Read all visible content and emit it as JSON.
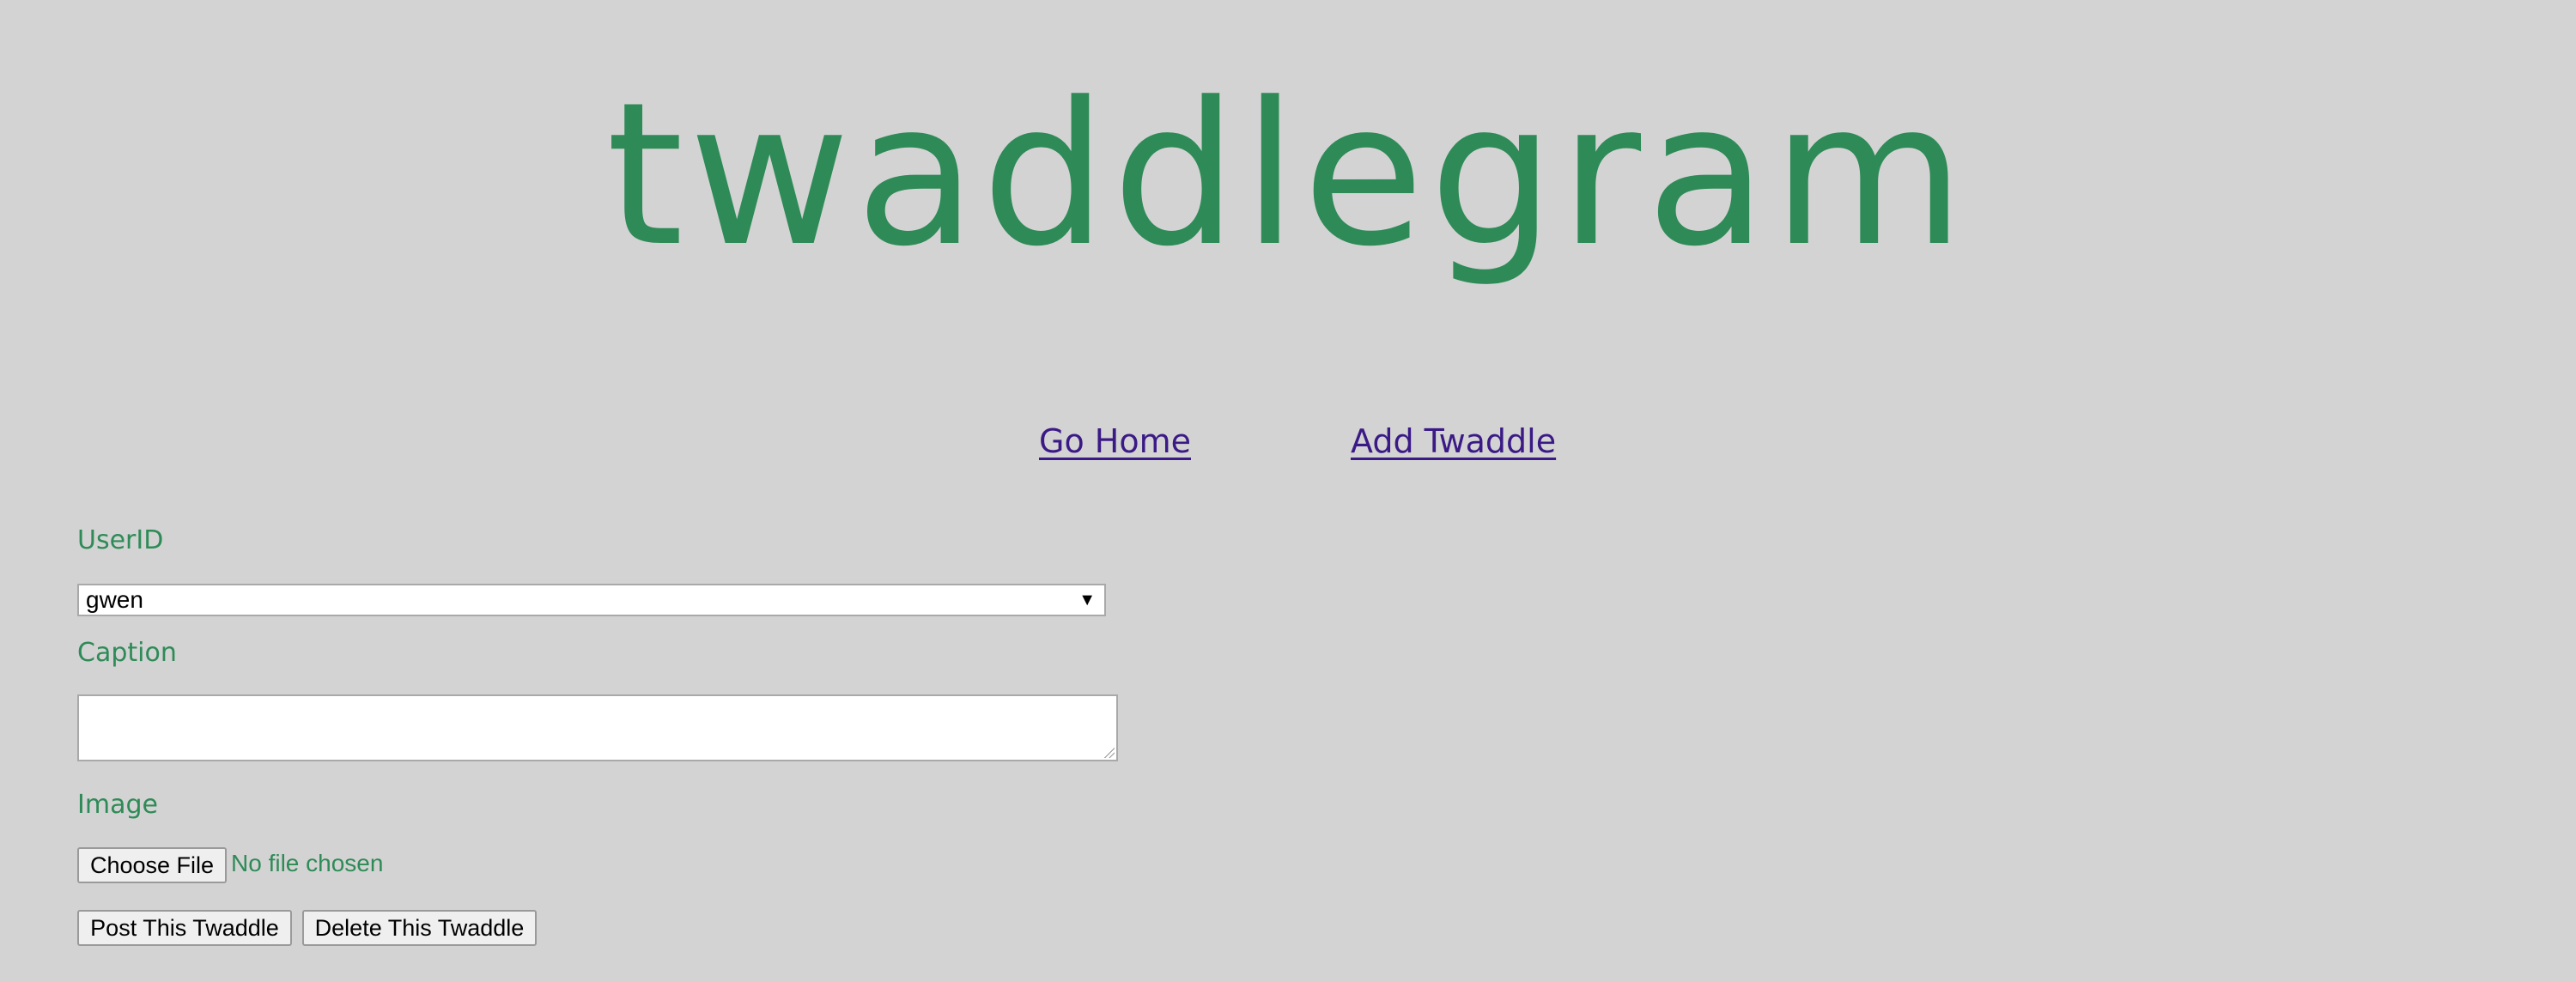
{
  "header": {
    "logo_text": "twaddlegram"
  },
  "nav": {
    "home_label": "Go Home",
    "add_label": "Add Twaddle"
  },
  "form": {
    "user_label": "UserID",
    "user_selected": "gwen",
    "caption_label": "Caption",
    "caption_value": "",
    "image_label": "Image",
    "choose_file_label": "Choose File",
    "file_status": "No file chosen",
    "post_label": "Post This Twaddle",
    "delete_label": "Delete This Twaddle"
  },
  "colors": {
    "background": "#d3d3d3",
    "accent_green": "#2e8b57",
    "link_purple": "#3b1a86"
  }
}
